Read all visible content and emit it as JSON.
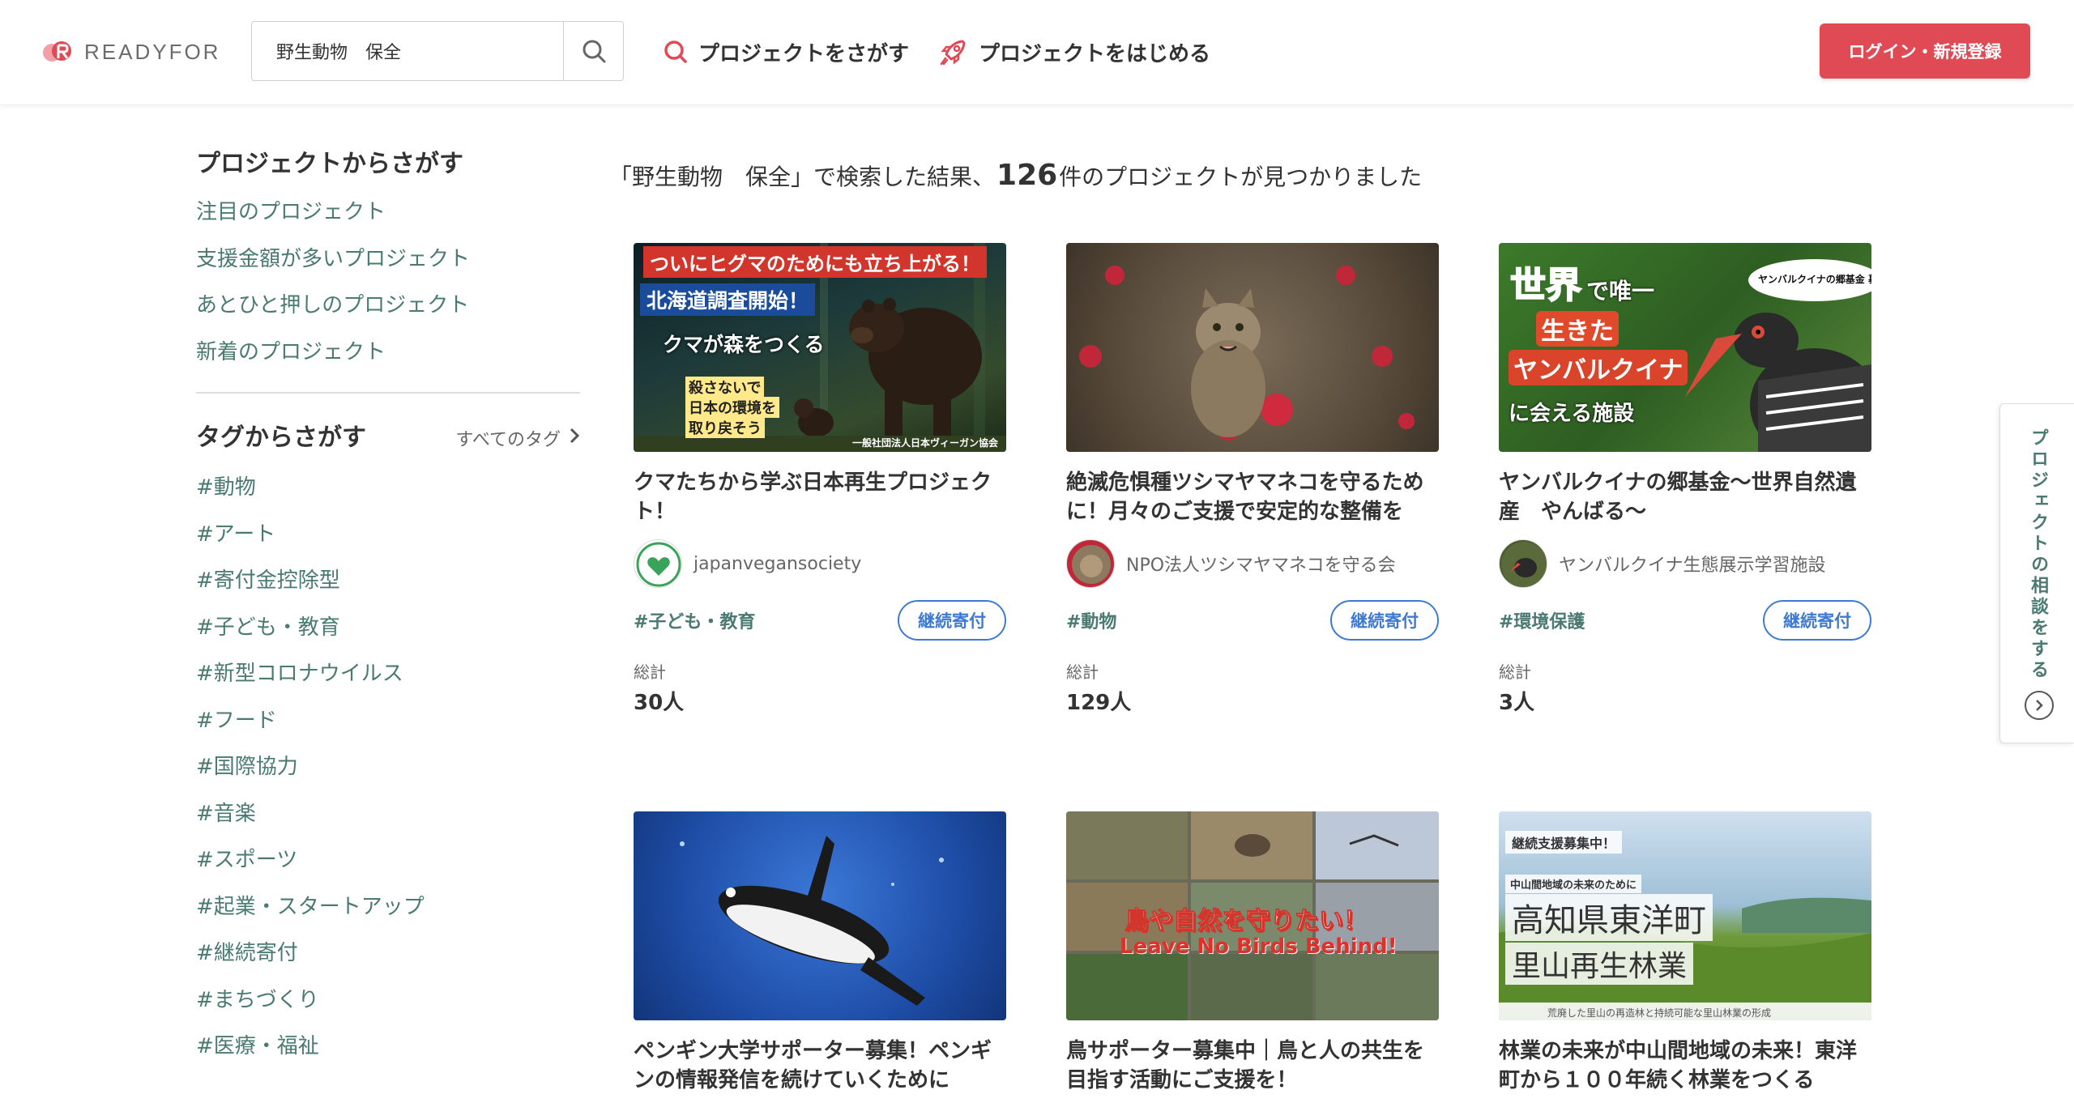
{
  "header": {
    "logo_text": "READYFOR",
    "search_value": "野生動物　保全",
    "nav_search": "プロジェクトをさがす",
    "nav_start": "プロジェクトをはじめる",
    "login_label": "ログイン・新規登録"
  },
  "sidebar": {
    "projects_heading": "プロジェクトからさがす",
    "project_links": [
      "注目のプロジェクト",
      "支援金額が多いプロジェクト",
      "あとひと押しのプロジェクト",
      "新着のプロジェクト"
    ],
    "tags_heading": "タグからさがす",
    "all_tags_label": "すべてのタグ",
    "tags": [
      "#動物",
      "#アート",
      "#寄付金控除型",
      "#子ども・教育",
      "#新型コロナウイルス",
      "#フード",
      "#国際協力",
      "#音楽",
      "#スポーツ",
      "#起業・スタートアップ",
      "#継続寄付",
      "#まちづくり",
      "#医療・福祉"
    ]
  },
  "results": {
    "prefix": "「野生動物　保全」で検索した結果、",
    "count": "126",
    "suffix": "件のプロジェクトが見つかりました"
  },
  "cards": [
    {
      "title": "クマたちから学ぶ日本再生プロジェクト！",
      "owner": "japanvegansociety",
      "tag": "#子ども・教育",
      "badge": "継続寄付",
      "total_label": "総計",
      "total_value": "30人",
      "thumb_texts": [
        "ついにヒグマのためにも立ち上がる！",
        "北海道調査開始！",
        "クマが森をつくる",
        "殺さないで",
        "日本の環境を",
        "取り戻そう",
        "一般社団法人日本ヴィーガン協会"
      ]
    },
    {
      "title": "絶滅危惧種ツシマヤマネコを守るために！月々のご支援で安定的な整備を",
      "owner": "NPO法人ツシマヤマネコを守る会",
      "tag": "#動物",
      "badge": "継続寄付",
      "total_label": "総計",
      "total_value": "129人",
      "thumb_texts": []
    },
    {
      "title": "ヤンバルクイナの郷基金〜世界自然遺産　やんばる〜",
      "owner": "ヤンバルクイナ生態展示学習施設",
      "tag": "#環境保護",
      "badge": "継続寄付",
      "total_label": "総計",
      "total_value": "3人",
      "thumb_texts": [
        "世界",
        "で唯一",
        "生きた",
        "ヤンバルクイナ",
        "に会える施設",
        "ヤンバルクイナの郷基金 募集中"
      ]
    },
    {
      "title": "ペンギン大学サポーター募集！ペンギンの情報発信を続けていくために",
      "thumb_texts": []
    },
    {
      "title": "鳥サポーター募集中｜鳥と人の共生を目指す活動にご支援を！",
      "thumb_texts": [
        "鳥や自然を守りたい！",
        "Leave No Birds Behind!"
      ]
    },
    {
      "title": "林業の未来が中山間地域の未来！東洋町から１００年続く林業をつくる",
      "thumb_texts": [
        "継続支援募集中！",
        "中山間地域の未来のために",
        "高知県東洋町",
        "里山再生林業",
        "荒廃した里山の再造林と持続可能な里山林業の形成"
      ]
    }
  ],
  "consult_label": "プロジェクトの相談をする",
  "colors": {
    "accent_red": "#e04a55",
    "link_teal": "#4a7a72",
    "badge_blue": "#3f7ad2"
  }
}
